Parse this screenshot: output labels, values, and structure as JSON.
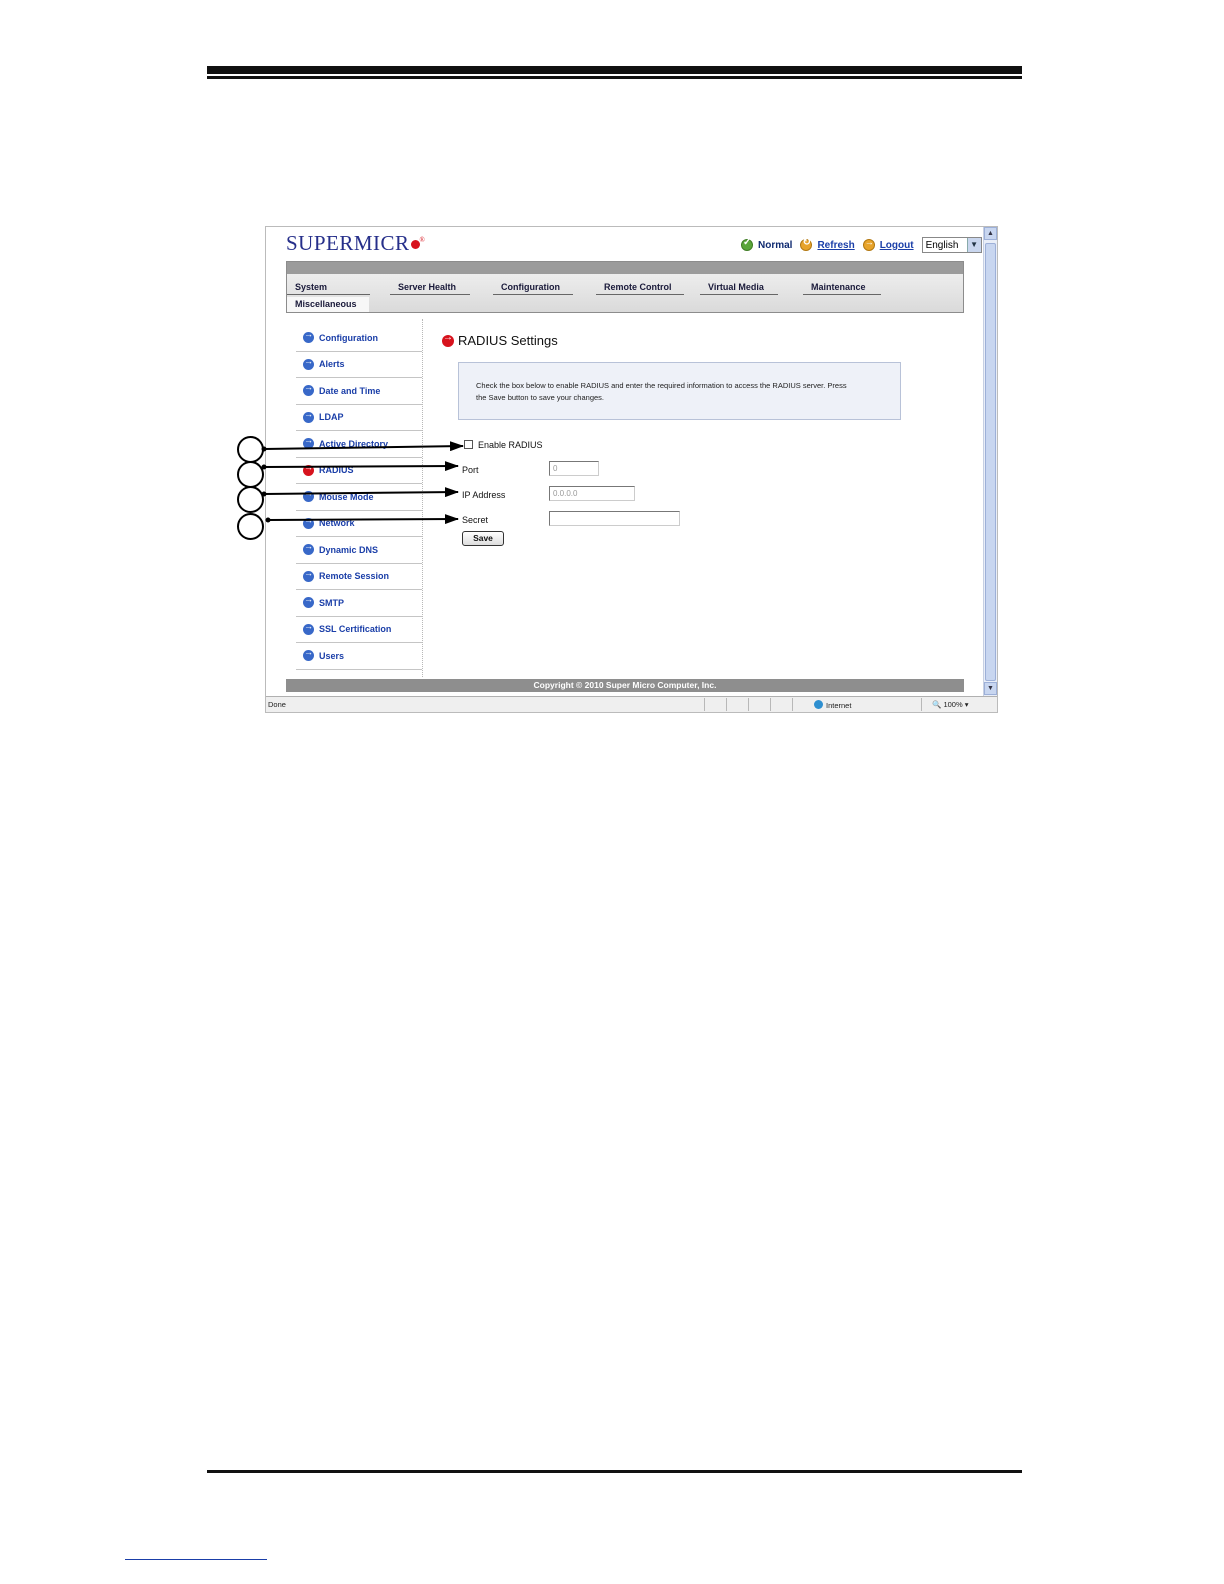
{
  "header": {
    "logo_text": "SUPERMICR",
    "status_label": "Normal",
    "refresh_label": "Refresh",
    "logout_label": "Logout",
    "language": "English"
  },
  "nav": {
    "tabs": [
      "System",
      "Server Health",
      "Configuration",
      "Remote Control",
      "Virtual Media",
      "Maintenance"
    ],
    "second_row_tab": "Miscellaneous"
  },
  "sidebar": {
    "items": [
      {
        "label": "Configuration",
        "icon": "arrow-right-icon"
      },
      {
        "label": "Alerts",
        "icon": "arrow-right-icon"
      },
      {
        "label": "Date and Time",
        "icon": "arrow-right-icon"
      },
      {
        "label": "LDAP",
        "icon": "arrow-right-icon"
      },
      {
        "label": "Active Directory",
        "icon": "arrow-right-icon"
      },
      {
        "label": "RADIUS",
        "icon": "arrow-right-icon",
        "active": true
      },
      {
        "label": "Mouse Mode",
        "icon": "arrow-right-icon"
      },
      {
        "label": "Network",
        "icon": "arrow-right-icon"
      },
      {
        "label": "Dynamic DNS",
        "icon": "arrow-right-icon"
      },
      {
        "label": "Remote Session",
        "icon": "arrow-right-icon"
      },
      {
        "label": "SMTP",
        "icon": "arrow-right-icon"
      },
      {
        "label": "SSL Certification",
        "icon": "arrow-right-icon"
      },
      {
        "label": "Users",
        "icon": "arrow-right-icon"
      }
    ]
  },
  "main": {
    "title": "RADIUS Settings",
    "info_line1": "Check the box below to enable RADIUS and enter the required information to access the RADIUS server. Press",
    "info_line2": "the Save button to save your changes.",
    "enable_label": "Enable RADIUS",
    "enable_checked": false,
    "port_label": "Port",
    "port_value": "0",
    "ip_label": "IP Address",
    "ip_value": "0.0.0.0",
    "secret_label": "Secret",
    "secret_value": "",
    "save_label": "Save"
  },
  "footer": {
    "copyright": "Copyright © 2010 Super Micro Computer, Inc."
  },
  "statusbar": {
    "text": "Done",
    "zone": "Internet",
    "zoom": "100%"
  },
  "colors": {
    "brand": "#262f8a",
    "accent_red": "#d7131d",
    "link": "#1a3ea8"
  }
}
